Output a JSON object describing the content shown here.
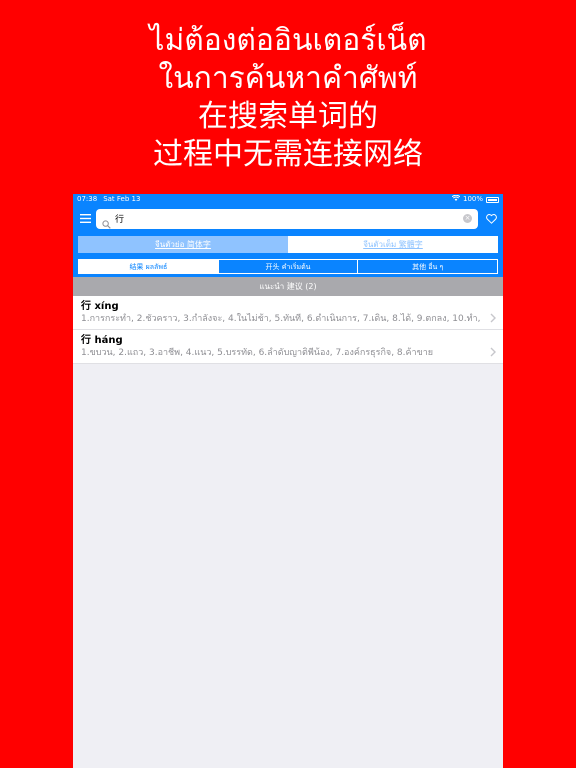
{
  "headline": {
    "lines": [
      "ไม่ต้องต่ออินเตอร์เน็ต",
      "ในการค้นหาคำศัพท์",
      "在搜索单词的",
      "过程中无需连接网络"
    ]
  },
  "statusbar": {
    "time": "07:38",
    "date": "Sat Feb 13",
    "battery": "100%"
  },
  "search": {
    "query": "行"
  },
  "script_toggle": {
    "simplified": "จีนตัวย่อ 简体字",
    "traditional": "จีนตัวเต็ม 繁體字"
  },
  "segments": [
    "结果 ผลลัพธ์",
    "开头 คำเริ่มต้น",
    "其他 อื่น ๆ"
  ],
  "section": {
    "title": "แนะนำ 建议 (2)"
  },
  "results": [
    {
      "headword": "行 xíng",
      "meaning": "1.การกระทำ, 2.ชั่วคราว, 3.กำลังจะ, 4.ในไม่ช้า, 5.ทันที, 6.ดำเนินการ, 7.เดิน, 8.ได้, 9.ตกลง, 10.ทำ, 1…"
    },
    {
      "headword": "行 háng",
      "meaning": "1.ขบวน, 2.แถว, 3.อาชีพ, 4.แนว, 5.บรรทัด, 6.ลำดับญาติพี่น้อง, 7.องค์กรธุรกิจ, 8.ค้าขาย"
    }
  ],
  "colors": {
    "background": "#ff0000",
    "accent": "#0a84ff"
  }
}
